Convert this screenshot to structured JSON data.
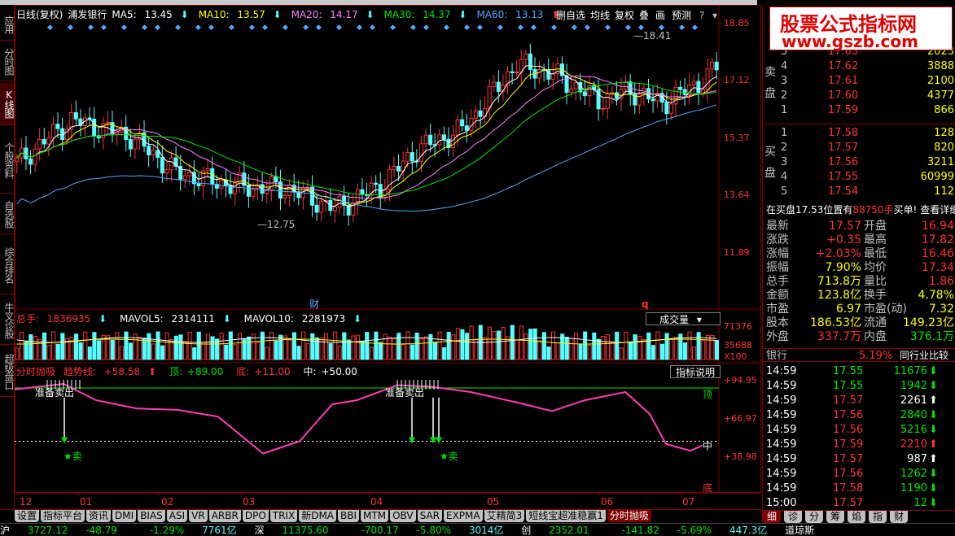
{
  "left_tabs": [
    "应用",
    "分时图",
    "K线图",
    "个股资料",
    "自选股",
    "综合排名",
    "牛叉诊股",
    "超级盘口"
  ],
  "left_tab_active": 2,
  "price_panel": {
    "title": "日线(复权)",
    "stock": "浦发银行",
    "ma": [
      {
        "name": "MA5:",
        "value": "13.45",
        "color": "#ffffff"
      },
      {
        "name": "MA10:",
        "value": "13.57",
        "color": "#ffff00"
      },
      {
        "name": "MA20:",
        "value": "14.17",
        "color": "#ff80ff"
      },
      {
        "name": "MA30:",
        "value": "14.37",
        "color": "#00e600"
      },
      {
        "name": "MA60:",
        "value": "13.13",
        "color": "#54a8ff"
      }
    ],
    "toolbar": [
      "删自选",
      "均线",
      "复权",
      "叠",
      "画",
      "预测"
    ],
    "y_ticks": [
      "18.85",
      "17.12",
      "15.37",
      "13.64",
      "11.89"
    ],
    "high_label": "18.41",
    "low_label": "12.75",
    "fin_marker": "财",
    "q_marker": "q"
  },
  "volume_panel": {
    "label_total": "总手:",
    "total": "1836935",
    "mavol5_label": "MAVOL5:",
    "mavol5": "2314111",
    "mavol10_label": "MAVOL10:",
    "mavol10": "2281973",
    "selector": "成交量",
    "y_ticks": [
      "71376",
      "35688",
      "X100"
    ]
  },
  "indicator_panel": {
    "name": "分时抛吸",
    "trend_label": "趋势线:",
    "trend": "+58.58",
    "top_label": "顶:",
    "top": "+89.00",
    "bottom_label": "底:",
    "bottom": "+11.00",
    "mid_label": "中:",
    "mid": "+50.00",
    "help": "指标说明",
    "y_ticks": [
      "+94.95",
      "+66.97",
      "+38.98"
    ],
    "tag_top": "顶",
    "tag_mid": "中",
    "tag_bottom": "底",
    "signal_sell_ready": "准备卖出",
    "signal_sell": "★卖"
  },
  "x_axis": [
    "12",
    "01",
    "02",
    "03",
    "04",
    "05",
    "06",
    "07"
  ],
  "bottom_tabs": [
    "设置",
    "指标平台",
    "资讯",
    "DMI",
    "BIAS",
    "ASI",
    "VR",
    "ARBR",
    "DPO",
    "TRIX",
    "新DMA",
    "BBI",
    "MTM",
    "OBV",
    "SAR",
    "EXPMA",
    "艾精简3",
    "短线宝超准稳赢1",
    "分时抛吸"
  ],
  "bottom_tab_active": 18,
  "right_bottom_tabs": [
    "细",
    "诊",
    "分",
    "筹",
    "焰",
    "指",
    "财"
  ],
  "watermark": {
    "line1": "股票公式指标网",
    "line2": "www.gszb.com"
  },
  "order_book": {
    "sell_label": "卖盘",
    "buy_label": "买盘",
    "sell": [
      {
        "level": "5",
        "price": "17.63",
        "vol": "2023"
      },
      {
        "level": "4",
        "price": "17.62",
        "vol": "3888"
      },
      {
        "level": "3",
        "price": "17.61",
        "vol": "2100"
      },
      {
        "level": "2",
        "price": "17.60",
        "vol": "4377"
      },
      {
        "level": "1",
        "price": "17.59",
        "vol": "866"
      }
    ],
    "buy": [
      {
        "level": "1",
        "price": "17.58",
        "vol": "128"
      },
      {
        "level": "2",
        "price": "17.57",
        "vol": "820"
      },
      {
        "level": "3",
        "price": "17.56",
        "vol": "3211"
      },
      {
        "level": "4",
        "price": "17.55",
        "vol": "60999"
      },
      {
        "level": "5",
        "price": "17.54",
        "vol": "112"
      }
    ],
    "note_prefix": "在买盘17.53位置有",
    "note_vol": "88750手",
    "note_suffix": "买单!",
    "note_link": "查看详细"
  },
  "stats": [
    {
      "l1": "最新",
      "v1": "17.57",
      "c1": "up",
      "l2": "开盘",
      "v2": "16.94",
      "c2": "up"
    },
    {
      "l1": "涨跌",
      "v1": "+0.35",
      "c1": "up",
      "l2": "最高",
      "v2": "17.82",
      "c2": "up"
    },
    {
      "l1": "涨幅",
      "v1": "+2.03%",
      "c1": "up",
      "l2": "最低",
      "v2": "16.46",
      "c2": "up"
    },
    {
      "l1": "振幅",
      "v1": "7.90%",
      "c1": "yl",
      "l2": "均价",
      "v2": "17.34",
      "c2": "up"
    },
    {
      "l1": "总手",
      "v1": "713.8万",
      "c1": "yl",
      "l2": "量比",
      "v2": "1.86",
      "c2": "up"
    },
    {
      "l1": "金额",
      "v1": "123.8亿",
      "c1": "yl",
      "l2": "换手",
      "v2": "4.78%",
      "c2": "yl"
    },
    {
      "l1": "市盈",
      "v1": "6.97",
      "c1": "yl",
      "l2": "市盈(动)",
      "v2": "7.32",
      "c2": "yl"
    },
    {
      "l1": "股本",
      "v1": "186.53亿",
      "c1": "yl",
      "l2": "流通",
      "v2": "149.23亿",
      "c2": "yl"
    },
    {
      "l1": "外盘",
      "v1": "337.7万",
      "c1": "up",
      "l2": "内盘",
      "v2": "376.1万",
      "c2": "dn"
    }
  ],
  "sector": {
    "name": "银行",
    "change": "5.19%",
    "compare": "同行业比较"
  },
  "ticks": [
    {
      "time": "14:59",
      "price": "17.55",
      "pc": "dn",
      "vol": "11676",
      "vc": "dn",
      "arrow": "⬇"
    },
    {
      "time": "14:59",
      "price": "17.55",
      "pc": "dn",
      "vol": "1942",
      "vc": "dn",
      "arrow": "⬇"
    },
    {
      "time": "14:59",
      "price": "17.57",
      "pc": "up",
      "vol": "2261",
      "vc": "wh",
      "arrow": "⬆"
    },
    {
      "time": "14:59",
      "price": "17.56",
      "pc": "up",
      "vol": "2840",
      "vc": "dn",
      "arrow": "⬇"
    },
    {
      "time": "14:59",
      "price": "17.56",
      "pc": "up",
      "vol": "5216",
      "vc": "dn",
      "arrow": "⬇"
    },
    {
      "time": "14:59",
      "price": "17.59",
      "pc": "up",
      "vol": "2210",
      "vc": "up",
      "arrow": "⬆"
    },
    {
      "time": "14:59",
      "price": "17.57",
      "pc": "up",
      "vol": "987",
      "vc": "wh",
      "arrow": "⬆"
    },
    {
      "time": "14:59",
      "price": "17.56",
      "pc": "up",
      "vol": "1262",
      "vc": "dn",
      "arrow": "⬇"
    },
    {
      "time": "14:59",
      "price": "17.58",
      "pc": "up",
      "vol": "1190",
      "vc": "dn",
      "arrow": "⬇"
    },
    {
      "time": "15:00",
      "price": "17.57",
      "pc": "up",
      "vol": "12",
      "vc": "dn",
      "arrow": "⬇"
    }
  ],
  "status_bar": {
    "sh_label": "沪",
    "sh_index": "3727.12",
    "sh_change": "-48.79",
    "sh_pct": "-1.29%",
    "sh_amount": "7761亿",
    "sz_label": "深",
    "sz_index": "11375.60",
    "sz_change": "-700.17",
    "sz_pct": "-5.80%",
    "cy_amount": "3014亿",
    "cy_label": "创",
    "cy_index": "2352.01",
    "cy_change": "-141.82",
    "cy_pct": "-5.69%",
    "dj_amount": "447.3亿",
    "dj_label": "道琼斯"
  }
}
